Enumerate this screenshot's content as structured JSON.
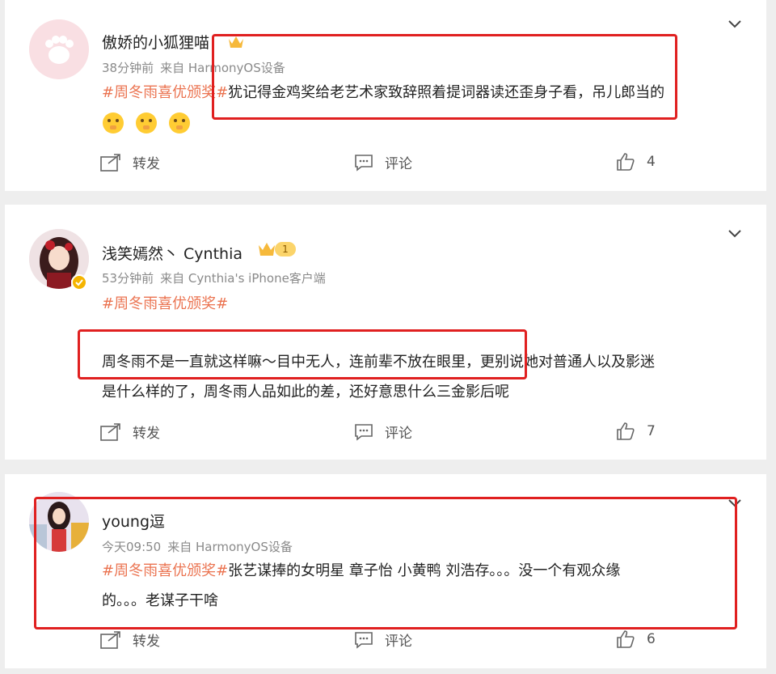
{
  "comments": [
    {
      "username": "傲娇的小狐狸喵",
      "time": "38分钟前",
      "source": "来自 HarmonyOS设备",
      "tag": "#周冬雨喜优颁奖#",
      "text": "犹记得金鸡奖给老艺术家致辞照着提词器读还歪身子看，吊儿郎当的",
      "emojis": [
        "shush-emoji",
        "shush-emoji",
        "shush-emoji"
      ],
      "repost_label": "转发",
      "comment_label": "评论",
      "like_count": "4"
    },
    {
      "username": "浅笑嫣然丶 Cynthia",
      "level_badge": "1",
      "time": "53分钟前",
      "source": "来自 Cynthia's iPhone客户端",
      "tag": "#周冬雨喜优颁奖#",
      "text_line1": "周冬雨不是一直就这样嘛～目中无人，连前辈不放在眼里，更别说她对普通人以及影迷",
      "text_line2": "是什么样的了，周冬雨人品如此的差，还好意思什么三金影后呢",
      "repost_label": "转发",
      "comment_label": "评论",
      "like_count": "7"
    },
    {
      "username": "young逗",
      "time": "今天09:50",
      "source": "来自 HarmonyOS设备",
      "tag": "#周冬雨喜优颁奖#",
      "text_line1": "张艺谋捧的女明星 章子怡 小黄鸭 刘浩存。。。没一个有观众缘",
      "text_line2": "的。。。老谋子干啥",
      "repost_label": "转发",
      "comment_label": "评论",
      "like_count": "6"
    }
  ],
  "colors": {
    "tag": "#eb7350",
    "highlight_box": "#e02020",
    "background": "#eeeeee"
  }
}
